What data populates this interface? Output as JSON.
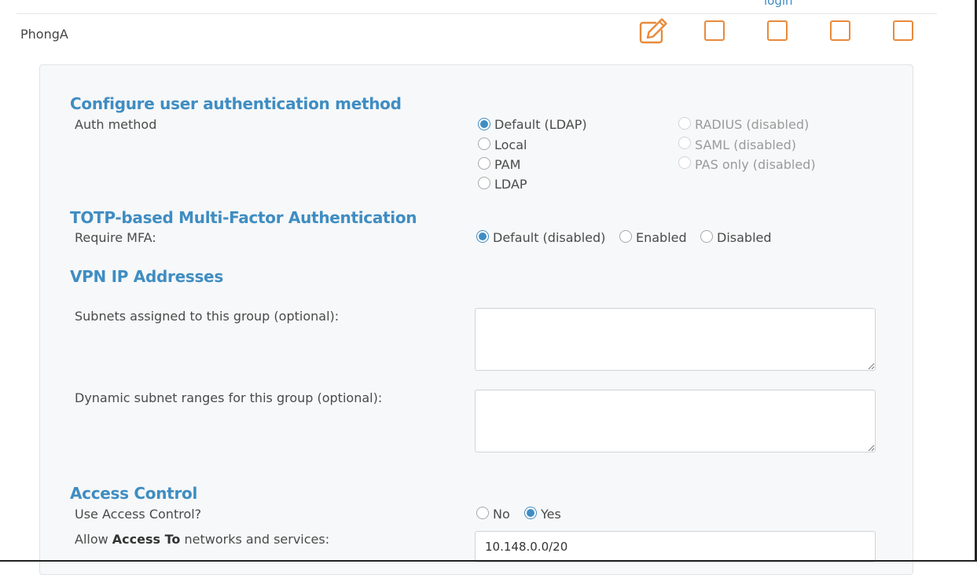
{
  "header": {
    "column_label": "login"
  },
  "group": {
    "name": "PhongA"
  },
  "auth": {
    "title": "Configure user authentication method",
    "label": "Auth method",
    "options": [
      "Default (LDAP)",
      "Local",
      "PAM",
      "LDAP",
      "RADIUS (disabled)",
      "SAML (disabled)",
      "PAS only (disabled)"
    ],
    "selected": "Default (LDAP)"
  },
  "mfa": {
    "title": "TOTP-based Multi-Factor Authentication",
    "label": "Require MFA:",
    "options": [
      "Default (disabled)",
      "Enabled",
      "Disabled"
    ],
    "selected": "Default (disabled)"
  },
  "vpn": {
    "title": "VPN IP Addresses",
    "subnets_label": "Subnets assigned to this group (optional):",
    "subnets_value": "",
    "dynamic_label": "Dynamic subnet ranges for this group (optional):",
    "dynamic_value": ""
  },
  "access": {
    "title": "Access Control",
    "use_label": "Use Access Control?",
    "options": [
      "No",
      "Yes"
    ],
    "selected": "Yes",
    "allow_prefix": "Allow ",
    "allow_bold": "Access To",
    "allow_suffix": " networks and services:",
    "allow_value": "10.148.0.0/20"
  },
  "colors": {
    "accent": "#3f8dc2",
    "action_orange": "#e88a3b",
    "panel_bg": "#f7f8f9"
  },
  "icons": {
    "edit": "pencil-square-icon"
  }
}
